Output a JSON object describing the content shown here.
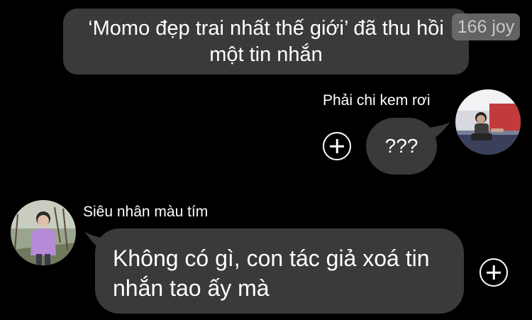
{
  "system_message": {
    "text": "‘Momo đẹp trai nhất thế giới’ đã thu hồi một tin nhắn"
  },
  "reaction_badge": {
    "label": "166 joy"
  },
  "outgoing": {
    "sender": "Phải chi kem rơi",
    "message": "???"
  },
  "incoming": {
    "sender": "Siêu nhân màu tím",
    "message": "Không có gì, con tác giả xoá tin nhắn tao ấy mà"
  },
  "colors": {
    "background": "#000000",
    "bubble": "#3a3a3c",
    "text": "#ffffff"
  }
}
